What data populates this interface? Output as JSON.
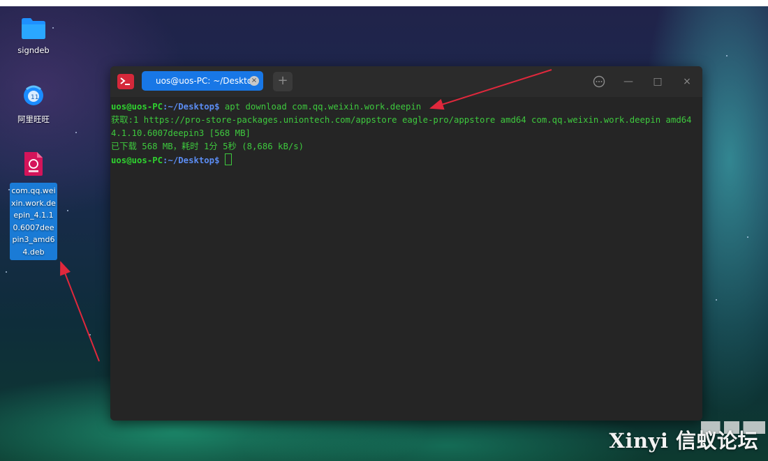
{
  "desktop": {
    "icons": [
      {
        "label": "signdeb"
      },
      {
        "label": "阿里旺旺"
      },
      {
        "label": "com.qq.weixin.work.deepin_4.1.10.6007deepin3_amd64.deb"
      }
    ]
  },
  "terminal": {
    "tab_title": "uos@uos-PC: ~/Desktop",
    "tab_close_glyph": "×",
    "new_tab_glyph": "+",
    "window_buttons": {
      "menu": "⋯",
      "minimize": "—",
      "maximize": "□",
      "close": "×"
    },
    "prompt_user": "uos@uos-PC",
    "prompt_path": ":~/Desktop$",
    "command": " apt download com.qq.weixin.work.deepin",
    "output_line1": "获取:1 https://pro-store-packages.uniontech.com/appstore eagle-pro/appstore amd64 com.qq.weixin.work.deepin amd64 4.1.10.6007deepin3 [568 MB]",
    "output_line2": "已下载 568 MB，耗时 1分 5秒 (8,686 kB/s)"
  },
  "watermark": {
    "text": "Xinyi 信蚁论坛"
  },
  "colors": {
    "accent": "#1877e6",
    "arrow": "#e0283c",
    "terminal_green": "#3ec93e",
    "prompt_blue": "#5b8cf2"
  },
  "icons": [
    "folder-icon",
    "aliwangwang-icon",
    "deb-package-icon",
    "terminal-app-icon"
  ]
}
